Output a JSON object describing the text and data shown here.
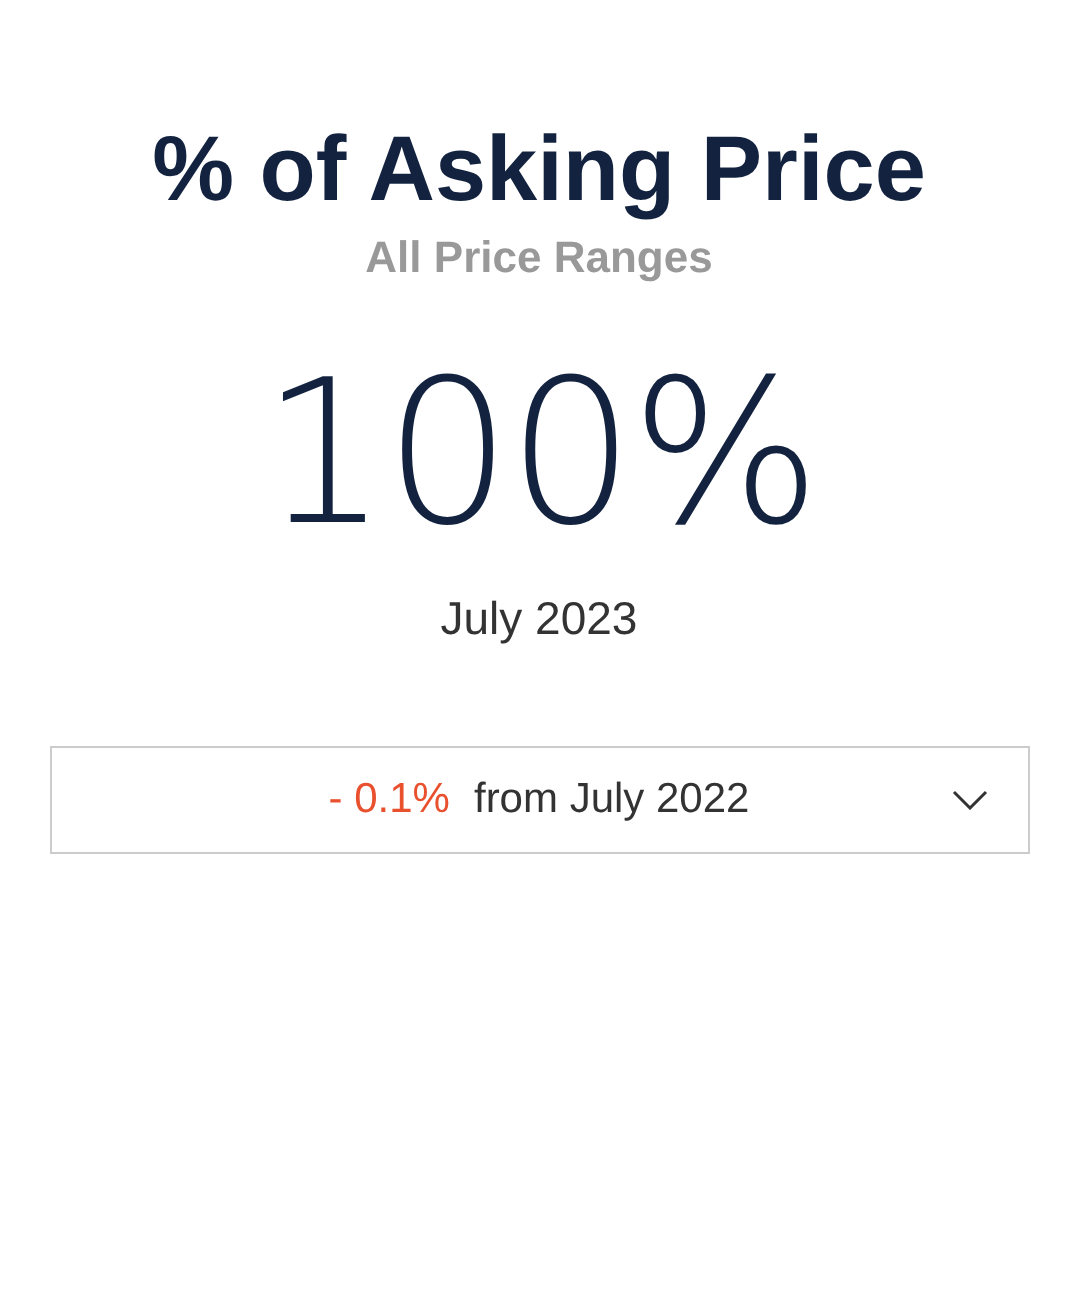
{
  "title": "% of Asking Price",
  "subtitle": "All Price Ranges",
  "value": "100%",
  "period": "July 2023",
  "comparison": {
    "change": "- 0.1%",
    "label": "from July 2022",
    "expanded": false
  }
}
